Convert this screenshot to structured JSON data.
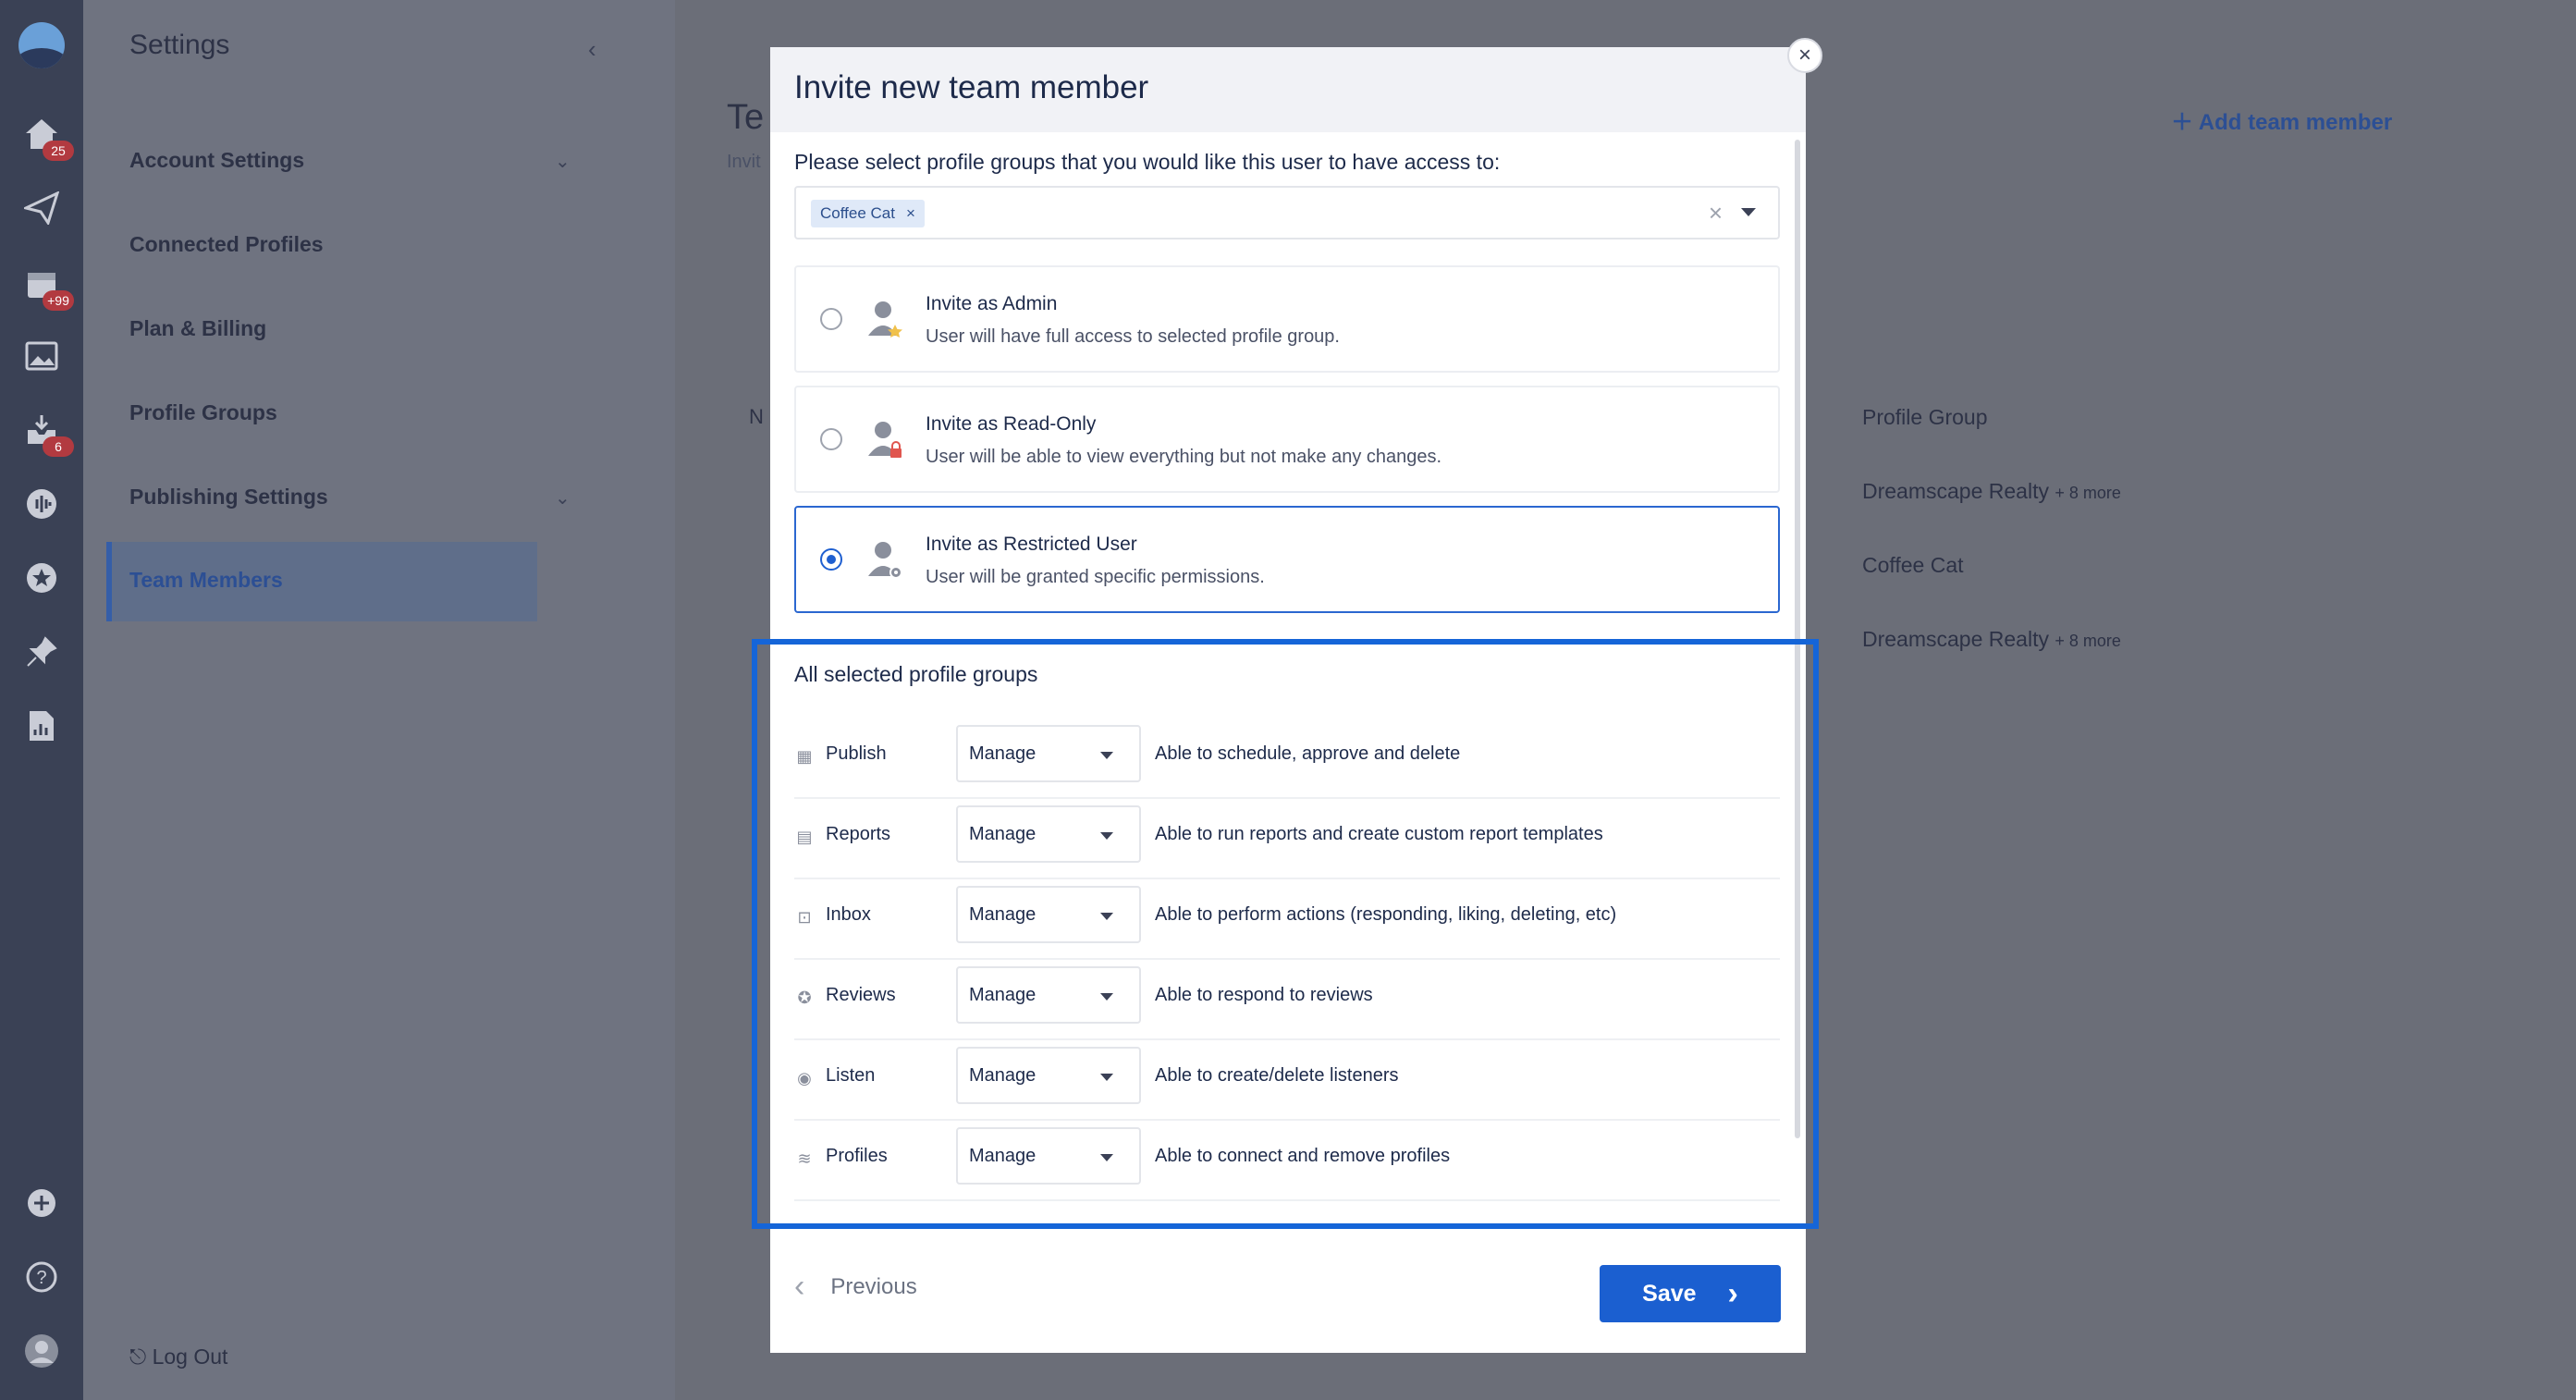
{
  "settings": {
    "title": "Settings",
    "items": [
      {
        "label": "Account Settings"
      },
      {
        "label": "Connected Profiles"
      },
      {
        "label": "Plan & Billing"
      },
      {
        "label": "Profile Groups"
      },
      {
        "label": "Publishing Settings"
      },
      {
        "label": "Team Members"
      }
    ],
    "logout": "Log Out"
  },
  "rail": {
    "badges": {
      "home": "25",
      "calendar": "+99",
      "inbox": "6"
    }
  },
  "background": {
    "title_fragment": "Te",
    "subtitle_fragment": "Invit",
    "column_fragment": "N",
    "add_member": "Add team member",
    "profile_group_header": "Profile Group",
    "rows": [
      {
        "group": "Dreamscape Realty",
        "more": "+ 8 more"
      },
      {
        "group": "Coffee Cat",
        "more": ""
      },
      {
        "group": "Dreamscape Realty",
        "more": "+ 8 more"
      }
    ]
  },
  "modal": {
    "title": "Invite new team member",
    "prompt": "Please select profile groups that you would like this user to have access to:",
    "selected_chip": "Coffee Cat",
    "roles": [
      {
        "title": "Invite as Admin",
        "desc": "User will have full access to selected profile group.",
        "selected": false
      },
      {
        "title": "Invite as Read-Only",
        "desc": "User will be able to view everything but not make any changes.",
        "selected": false
      },
      {
        "title": "Invite as Restricted User",
        "desc": "User will be granted specific permissions.",
        "selected": true
      }
    ],
    "section_title": "All selected profile groups",
    "permissions": [
      {
        "label": "Publish",
        "value": "Manage",
        "desc": "Able to schedule, approve and delete",
        "icon": "calendar-icon"
      },
      {
        "label": "Reports",
        "value": "Manage",
        "desc": "Able to run reports and create custom report templates",
        "icon": "report-icon"
      },
      {
        "label": "Inbox",
        "value": "Manage",
        "desc": "Able to perform actions (responding, liking, deleting, etc)",
        "icon": "inbox-icon"
      },
      {
        "label": "Reviews",
        "value": "Manage",
        "desc": "Able to respond to reviews",
        "icon": "star-icon"
      },
      {
        "label": "Listen",
        "value": "Manage",
        "desc": "Able to create/delete listeners",
        "icon": "waveform-icon"
      },
      {
        "label": "Profiles",
        "value": "Manage",
        "desc": "Able to connect and remove profiles",
        "icon": "stack-icon"
      }
    ],
    "previous": "Previous",
    "save": "Save"
  },
  "colors": {
    "accent": "#1B5FD0",
    "highlight": "#1565D8",
    "rail": "#3A4155",
    "overlay": "#6B6E78"
  }
}
